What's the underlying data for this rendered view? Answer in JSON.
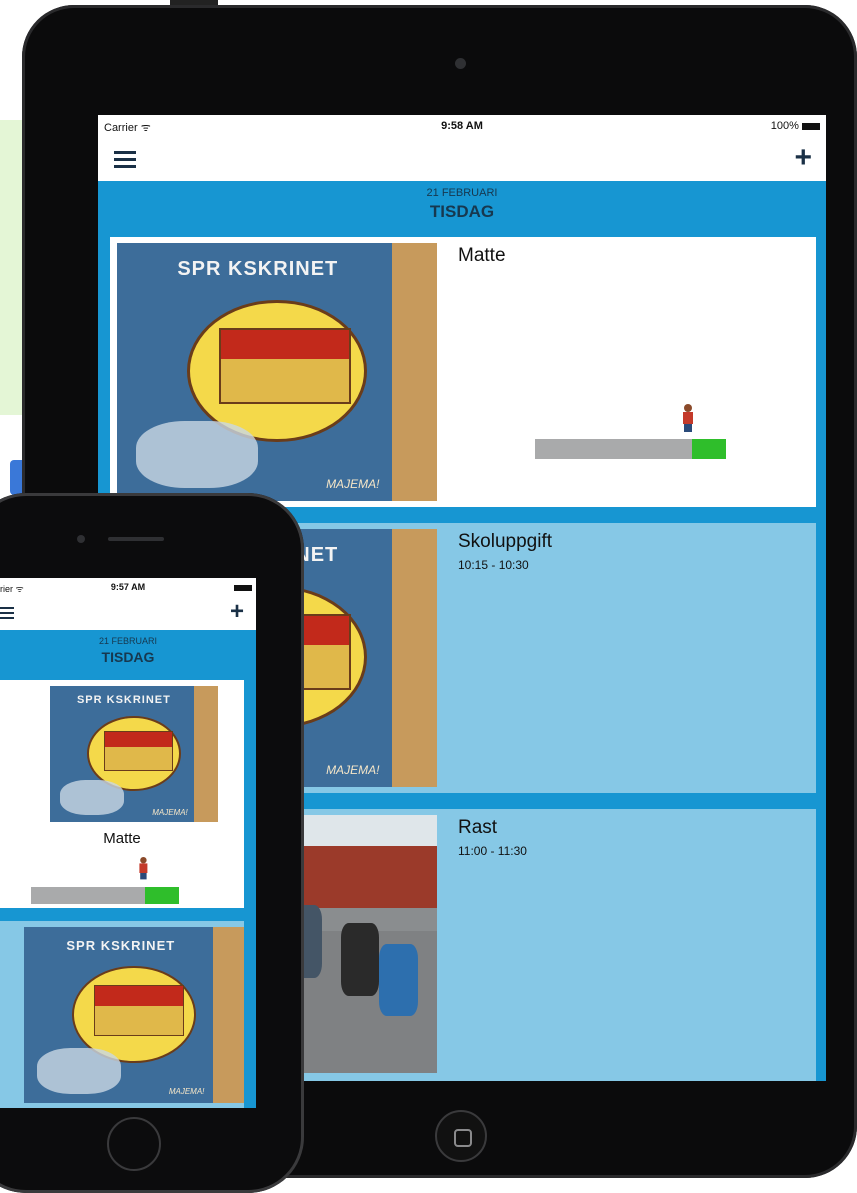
{
  "ipad": {
    "status": {
      "carrier": "Carrier",
      "time": "9:58 AM",
      "battery": "100%"
    },
    "header": {
      "date": "21 FEBRUARI",
      "day": "TISDAG"
    },
    "cards": [
      {
        "title": "Matte",
        "time": "",
        "progress": 0.82
      },
      {
        "title": "Skoluppgift",
        "time": "10:15 - 10:30"
      },
      {
        "title": "Rast",
        "time": "11:00 - 11:30"
      }
    ],
    "book": {
      "title": "SPR KSKRINET",
      "brand": "MAJEMA!"
    }
  },
  "iphone": {
    "status": {
      "carrier": "rier",
      "time": "9:57 AM"
    },
    "header": {
      "date": "21 FEBRUARI",
      "day": "TISDAG"
    },
    "cards": [
      {
        "title": "Matte",
        "progress": 0.77
      }
    ],
    "book": {
      "title": "SPR KSKRINET",
      "brand": "MAJEMA!"
    }
  },
  "colors": {
    "accent": "#1796d2",
    "card_light": "#86c8e6",
    "progress_done": "#2fbe2b",
    "progress_todo": "#a9aaab"
  },
  "icons": [
    "menu-icon",
    "plus-icon",
    "wifi-icon",
    "battery-icon",
    "home-button-icon"
  ]
}
